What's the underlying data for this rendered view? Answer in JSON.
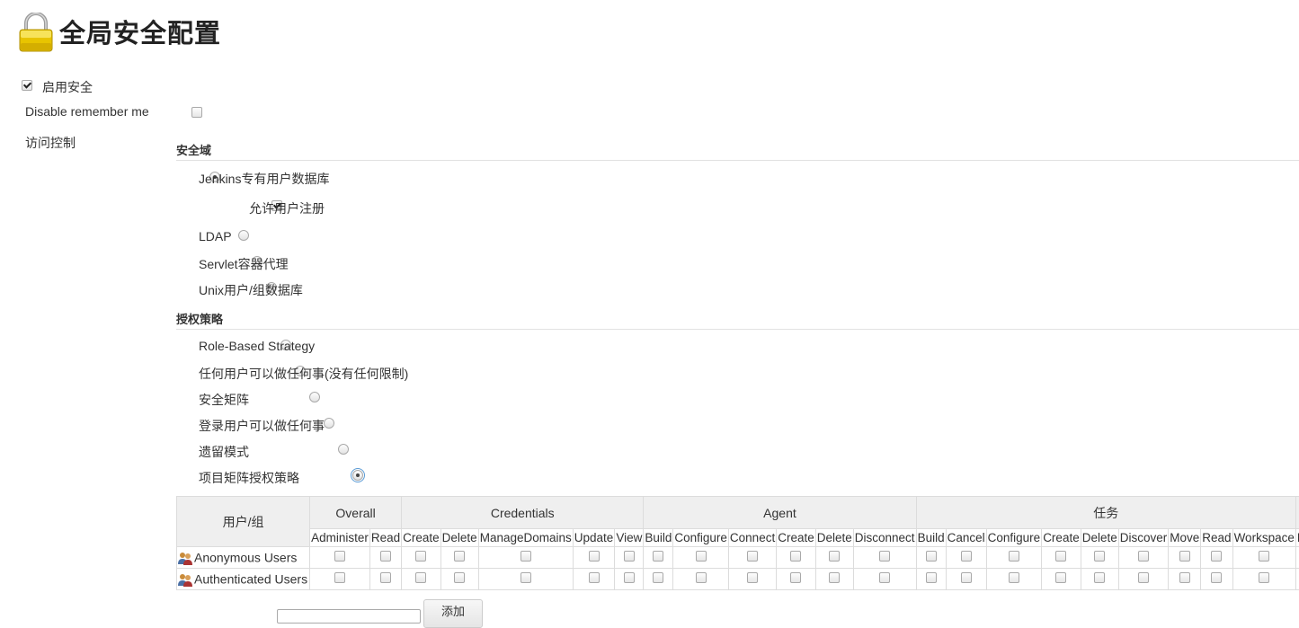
{
  "header": {
    "title": "全局安全配置",
    "icon": "lock-icon"
  },
  "enable_security": {
    "label": "启用安全",
    "checked": true
  },
  "disable_remember_me": {
    "label": "Disable remember me",
    "checked": false
  },
  "access_control": {
    "label": "访问控制"
  },
  "security_realm": {
    "heading": "安全域",
    "options": [
      {
        "label": "Jenkins专有用户数据库",
        "selected": true
      },
      {
        "label": "LDAP",
        "selected": false
      },
      {
        "label": "Servlet容器代理",
        "selected": false
      },
      {
        "label": "Unix用户/组数据库",
        "selected": false
      }
    ],
    "allow_signup": {
      "label": "允许用户注册",
      "checked": true
    }
  },
  "authorization": {
    "heading": "授权策略",
    "options": [
      {
        "label": "Role-Based Strategy",
        "selected": false
      },
      {
        "label": "任何用户可以做任何事(没有任何限制)",
        "selected": false
      },
      {
        "label": "安全矩阵",
        "selected": false
      },
      {
        "label": "登录用户可以做任何事",
        "selected": false
      },
      {
        "label": "遗留模式",
        "selected": false
      },
      {
        "label": "项目矩阵授权策略",
        "selected": true
      }
    ]
  },
  "matrix": {
    "user_header": "用户/组",
    "groups": [
      {
        "name": "Overall",
        "perms": [
          "Administer",
          "Read"
        ]
      },
      {
        "name": "Credentials",
        "perms": [
          "Create",
          "Delete",
          "ManageDomains",
          "Update",
          "View"
        ]
      },
      {
        "name": "Agent",
        "perms": [
          "Build",
          "Configure",
          "Connect",
          "Create",
          "Delete",
          "Disconnect"
        ]
      },
      {
        "name": "任务",
        "perms": [
          "Build",
          "Cancel",
          "Configure",
          "Create",
          "Delete",
          "Discover",
          "Move",
          "Read",
          "Workspace"
        ]
      },
      {
        "name": "",
        "perms": [
          "De"
        ]
      }
    ],
    "rows": [
      {
        "user": "Anonymous Users",
        "icon": "user-group-icon"
      },
      {
        "user": "Authenticated Users",
        "icon": "user-group-icon"
      }
    ]
  },
  "add_user": {
    "button_label": "添加",
    "input_value": ""
  }
}
